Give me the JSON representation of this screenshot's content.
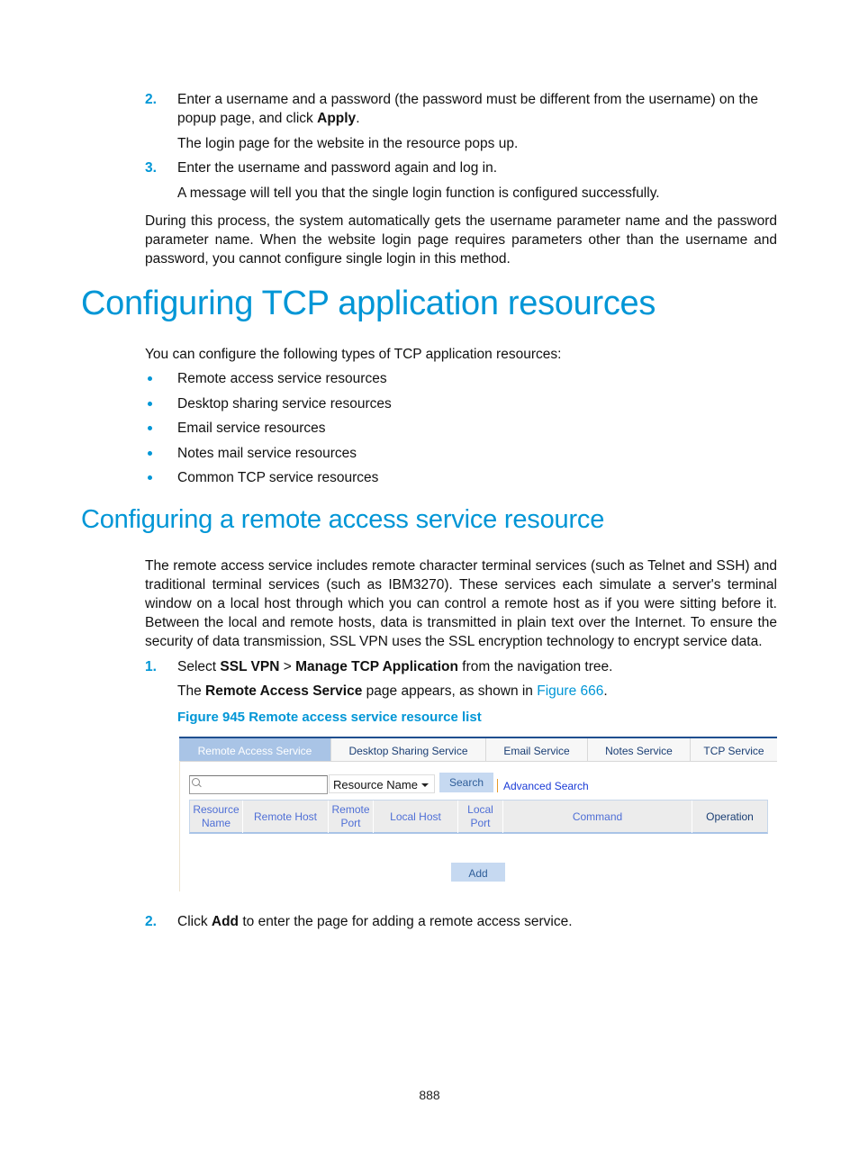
{
  "steps_top": [
    {
      "num": "2.",
      "text_before": "Enter a username and a password (the password must be different from the username) on the popup page, and click ",
      "bold": "Apply",
      "text_after": ".",
      "note": "The login page for the website in the resource pops up."
    },
    {
      "num": "3.",
      "text": "Enter the username and password again and log in.",
      "note": "A message will tell you that the single login function is configured successfully."
    }
  ],
  "process_paragraph": "During this process, the system automatically gets the username parameter name and the password parameter name. When the website login page requires parameters other than the username and password, you cannot configure single login in this method.",
  "section": {
    "title": "Configuring TCP application resources",
    "intro": "You can configure the following types of TCP application resources:",
    "bullets": [
      "Remote access service resources",
      "Desktop sharing service resources",
      "Email service resources",
      "Notes mail service resources",
      "Common TCP service resources"
    ]
  },
  "subsection": {
    "title": "Configuring a remote access service resource",
    "paragraph": "The remote access service includes remote character terminal services (such as Telnet and SSH) and traditional terminal services (such as IBM3270). These services each simulate a server's terminal window on a local host through which you can control a remote host as if you were sitting before it. Between the local and remote hosts, data is transmitted in plain text over the Internet. To ensure the security of data transmission, SSL VPN uses the SSL encryption technology to encrypt service data.",
    "step1": {
      "num": "1.",
      "pre": "Select ",
      "b1": "SSL VPN",
      "mid": " > ",
      "b2": "Manage TCP Application",
      "post": " from the navigation tree."
    },
    "step1_note": {
      "pre": "The ",
      "bold": "Remote Access Service",
      "mid": " page appears, as shown in ",
      "link": "Figure 666",
      "post": "."
    },
    "figure_caption": "Figure 945 Remote access service resource list",
    "step2": {
      "num": "2.",
      "pre": "Click ",
      "bold": "Add",
      "post": " to enter the page for adding a remote access service."
    }
  },
  "ui": {
    "tabs": [
      {
        "label": "Remote Access Service",
        "active": true
      },
      {
        "label": "Desktop Sharing Service",
        "active": false
      },
      {
        "label": "Email Service",
        "active": false
      },
      {
        "label": "Notes Service",
        "active": false
      },
      {
        "label": "TCP Service",
        "active": false
      }
    ],
    "search": {
      "value": "",
      "placeholder": ""
    },
    "search_field_select": "Resource Name",
    "search_button": "Search",
    "advanced_search": "Advanced Search",
    "columns": [
      {
        "line1": "Resource",
        "line2": "Name"
      },
      {
        "line1": "Remote Host",
        "line2": ""
      },
      {
        "line1": "Remote",
        "line2": "Port"
      },
      {
        "line1": "Local Host",
        "line2": ""
      },
      {
        "line1": "Local",
        "line2": "Port"
      },
      {
        "line1": "Command",
        "line2": ""
      },
      {
        "line1": "Operation",
        "line2": ""
      }
    ],
    "add_button": "Add"
  },
  "page_number": "888",
  "colors": {
    "accent": "#0096d6",
    "tab_active": "#a9c4e6",
    "button": "#c6d9f1"
  }
}
